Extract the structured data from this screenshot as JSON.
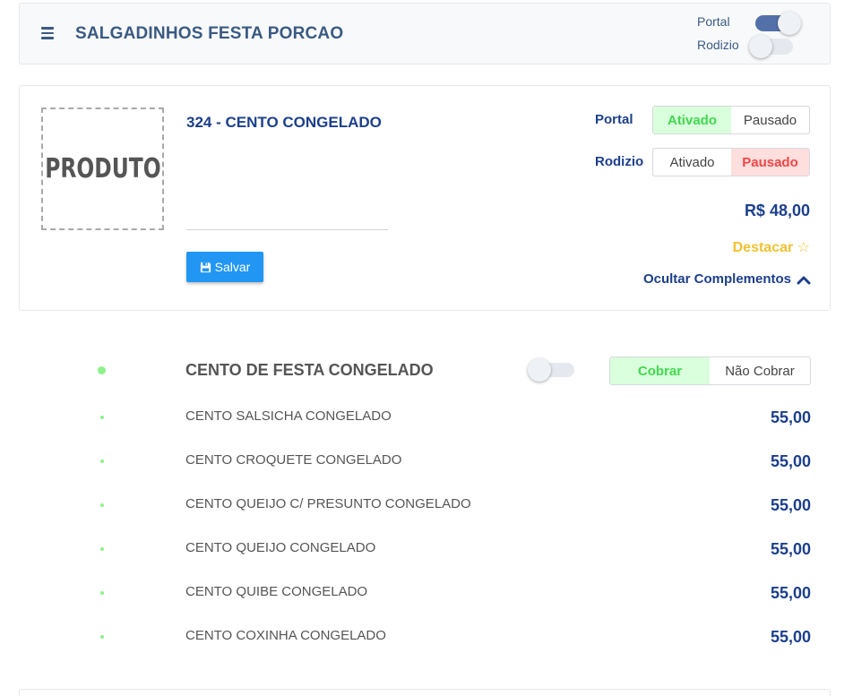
{
  "header": {
    "store_name": "SALGADINHOS FESTA PORCAO",
    "portal_label": "Portal",
    "rodizio_label": "Rodizio",
    "portal_on": true,
    "rodizio_on": false
  },
  "product": {
    "image_text": "PRODUTO",
    "name": "324 - CENTO CONGELADO",
    "save_label": "Salvar",
    "portal_label": "Portal",
    "rodizio_label": "Rodizio",
    "portal_options": [
      "Ativado",
      "Pausado"
    ],
    "portal_selected": "Ativado",
    "rodizio_options": [
      "Ativado",
      "Pausado"
    ],
    "rodizio_selected": "Pausado",
    "price": "R$ 48,00",
    "destacar_label": "Destacar ☆",
    "ocultar_label": "Ocultar Complementos"
  },
  "group": {
    "title": "CENTO DE FESTA CONGELADO",
    "charge_options": [
      "Cobrar",
      "Não Cobrar"
    ],
    "charge_selected": "Cobrar",
    "items": [
      {
        "name": "CENTO SALSICHA CONGELADO",
        "price": "55,00"
      },
      {
        "name": "CENTO CROQUETE CONGELADO",
        "price": "55,00"
      },
      {
        "name": "CENTO QUEIJO C/ PRESUNTO CONGELADO",
        "price": "55,00"
      },
      {
        "name": "CENTO QUEIJO CONGELADO",
        "price": "55,00"
      },
      {
        "name": "CENTO QUIBE CONGELADO",
        "price": "55,00"
      },
      {
        "name": "CENTO COXINHA CONGELADO",
        "price": "55,00"
      }
    ]
  },
  "colors": {
    "primary_blue": "#1c3f8c",
    "button_blue": "#2196f3",
    "active_green": "#41d94f",
    "paused_red": "#f24646",
    "highlight_yellow": "#f2c232"
  }
}
